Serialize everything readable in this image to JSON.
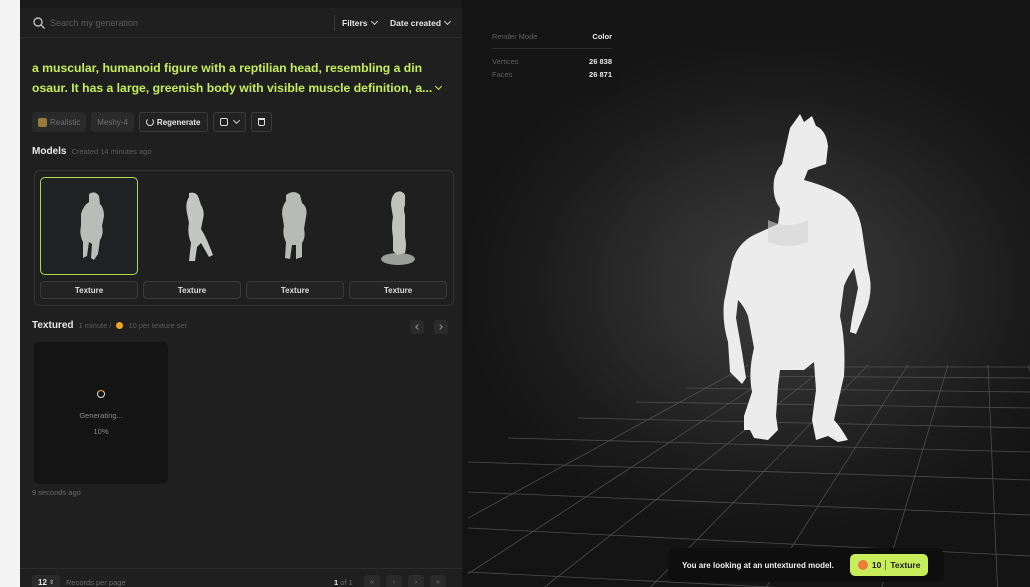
{
  "search": {
    "placeholder": "Search my generation"
  },
  "filters": {
    "filters_label": "Filters",
    "sort_label": "Date created"
  },
  "prompt": {
    "line1": "a muscular, humanoid figure with a reptilian head, resembling a din",
    "line2": "osaur. It has a large, greenish body with visible muscle definition, a..."
  },
  "tags": {
    "style": "Realistic",
    "model": "Meshy-4",
    "regenerate": "Regenerate"
  },
  "models": {
    "title": "Models",
    "subtitle": "Created 14 minutes ago",
    "items": [
      {
        "button": "Texture",
        "selected": true
      },
      {
        "button": "Texture",
        "selected": false
      },
      {
        "button": "Texture",
        "selected": false
      },
      {
        "button": "Texture",
        "selected": false
      }
    ]
  },
  "textured": {
    "title": "Textured",
    "time": "1 minute /",
    "cost": "10 per texture set",
    "status": "Generating...",
    "progress": "10%",
    "age": "9 seconds ago"
  },
  "footer": {
    "records_per_page": "12",
    "records_label": "Records per page",
    "page_current": "1",
    "page_of": "of 1"
  },
  "viewer": {
    "render_mode_label": "Render Mode",
    "render_mode_value": "Color",
    "vertices_label": "Vertices",
    "vertices_value": "26 838",
    "faces_label": "Faces",
    "faces_value": "26 871",
    "notice": "You are looking at an untextured model.",
    "cta_cost": "10",
    "cta_label": "Texture"
  },
  "colors": {
    "accent": "#c7ee5a",
    "coin": "#f2a71b",
    "panel": "#1f1f20",
    "viewport": "#1b1b1b"
  }
}
